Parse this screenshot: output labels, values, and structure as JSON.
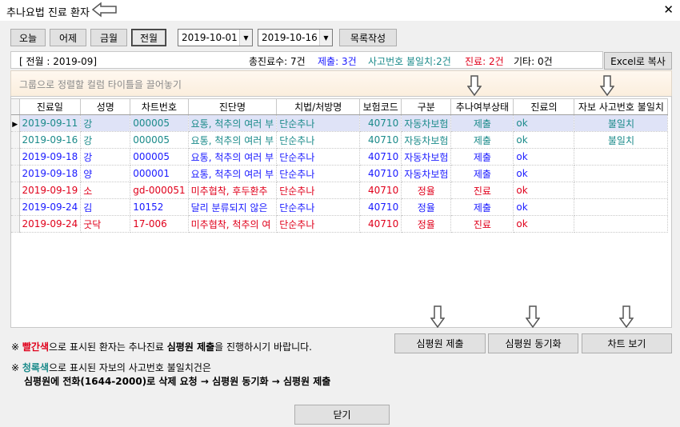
{
  "window": {
    "title": "추나요법 진료 환자",
    "close_glyph": "✕"
  },
  "toolbar": {
    "btn_today": "오늘",
    "btn_yesterday": "어제",
    "btn_this_month": "금월",
    "btn_last_month": "전월",
    "date_from": "2019-10-01",
    "date_to": "2019-10-16",
    "btn_make_list": "목록작성"
  },
  "summary": {
    "period": "[ 전월 : 2019-09]",
    "total": "총진료수: 7건",
    "submitted": "제출: 3건",
    "accident_mismatch": "사고번호 불일치:2건",
    "treatment": "진료: 2건",
    "other": "기타: 0건",
    "excel_button": "Excel로 복사"
  },
  "group_hint": "그룹으로 정렬할 컬럼 타이틀을 끌어놓기",
  "columns": [
    "진료일",
    "성명",
    "차트번호",
    "진단명",
    "치법/처방명",
    "보험코드",
    "구분",
    "추나여부상태",
    "진료의",
    "자보 사고번호 불일치"
  ],
  "rows": [
    {
      "date": "2019-09-11",
      "name": "강",
      "chart": "000005",
      "diag": "요통, 척추의 여러 부",
      "rx": "단순추나",
      "code": "40710",
      "type": "자동차보험",
      "status": "제출",
      "doctor": "ok",
      "mismatch": "불일치",
      "color": "teal",
      "selected": true
    },
    {
      "date": "2019-09-16",
      "name": "강",
      "chart": "000005",
      "diag": "요통, 척추의 여러 부",
      "rx": "단순추나",
      "code": "40710",
      "type": "자동차보험",
      "status": "제출",
      "doctor": "ok",
      "mismatch": "불일치",
      "color": "teal",
      "selected": false
    },
    {
      "date": "2019-09-18",
      "name": "강",
      "chart": "000005",
      "diag": "요통, 척추의 여러 부",
      "rx": "단순추나",
      "code": "40710",
      "type": "자동차보험",
      "status": "제출",
      "doctor": "ok",
      "mismatch": "",
      "color": "blue",
      "selected": false
    },
    {
      "date": "2019-09-18",
      "name": "양",
      "chart": "000001",
      "diag": "요통, 척추의 여러 부",
      "rx": "단순추나",
      "code": "40710",
      "type": "자동차보험",
      "status": "제출",
      "doctor": "ok",
      "mismatch": "",
      "color": "blue",
      "selected": false
    },
    {
      "date": "2019-09-19",
      "name": "소",
      "chart": "gd-000051",
      "diag": "미추협착, 후두환추",
      "rx": "단순추나",
      "code": "40710",
      "type": "정율",
      "status": "진료",
      "doctor": "ok",
      "mismatch": "",
      "color": "red",
      "selected": false
    },
    {
      "date": "2019-09-24",
      "name": "김",
      "chart": "10152",
      "diag": "달리 분류되지 않은",
      "rx": "단순추나",
      "code": "40710",
      "type": "정율",
      "status": "제출",
      "doctor": "ok",
      "mismatch": "",
      "color": "blue",
      "selected": false
    },
    {
      "date": "2019-09-24",
      "name": "굿닥",
      "chart": "17-006",
      "diag": "미추협착, 척추의 여",
      "rx": "단순추나",
      "code": "40710",
      "type": "정율",
      "status": "진료",
      "doctor": "ok",
      "mismatch": "",
      "color": "red",
      "selected": false
    }
  ],
  "notes": {
    "mark": "※",
    "red_word": "빨간색",
    "line1_a": "으로 표시된 환자는 추나진료 ",
    "line1_b": "심평원 제출",
    "line1_c": "을 진행하시기 바랍니다.",
    "teal_word": "청록색",
    "line2_a": "으로 표시된 자보의 사고번호 불일치건은",
    "line3": "심평원에 전화(1644-2000)로 삭제 요청 → 심평원 동기화 → 심평원 제출"
  },
  "actions": {
    "btn_submit": "심평원 제출",
    "btn_sync": "심평원 동기화",
    "btn_chart": "차트 보기",
    "btn_close": "닫기"
  },
  "colors": {
    "red": "#e0001b",
    "blue": "#1a1aff",
    "teal": "#1a8a8a",
    "selected_bg": "#dfe3f7"
  }
}
